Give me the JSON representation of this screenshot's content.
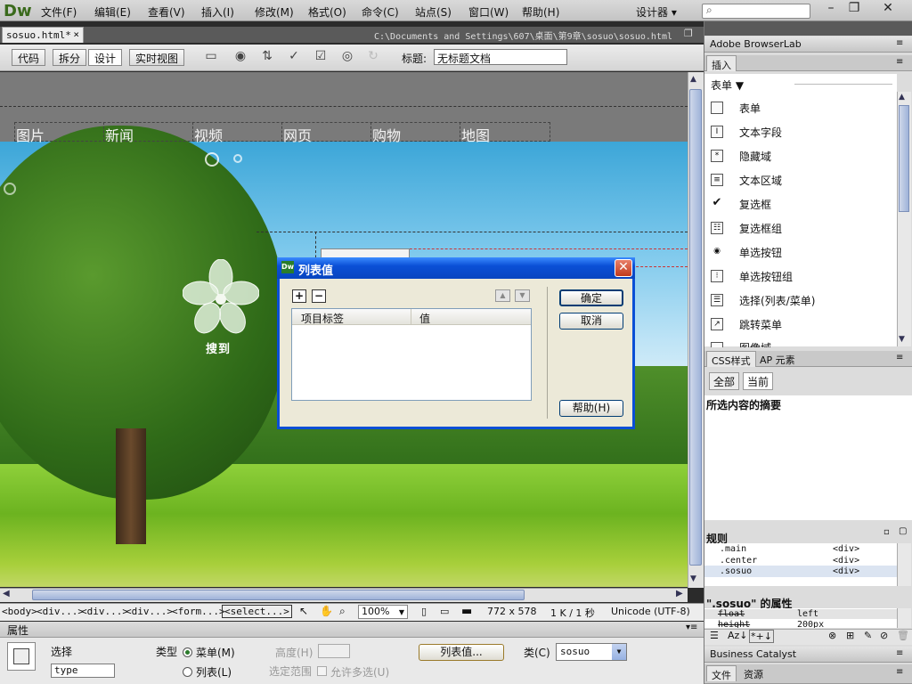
{
  "app": {
    "logo": "Dw",
    "workspace": "设计器 ▾"
  },
  "menu": [
    "文件(F)",
    "编辑(E)",
    "查看(V)",
    "插入(I)",
    "修改(M)",
    "格式(O)",
    "命令(C)",
    "站点(S)",
    "窗口(W)",
    "帮助(H)"
  ],
  "search": {
    "placeholder": ""
  },
  "document": {
    "tab": "sosuo.html*",
    "path": "C:\\Documents and Settings\\607\\桌面\\第9章\\sosuo\\sosuo.html",
    "views": [
      "代码",
      "拆分",
      "设计",
      "实时视图"
    ],
    "active_view": "设计",
    "title_label": "标题:",
    "title_value": "无标题文档"
  },
  "page": {
    "nav": [
      "图片",
      "新闻",
      "视频",
      "网页",
      "购物",
      "地图"
    ],
    "logo_text": "搜到"
  },
  "dialog": {
    "title": "列表值",
    "columns": [
      "项目标签",
      "值"
    ],
    "ok": "确定",
    "cancel": "取消",
    "help": "帮助(H)"
  },
  "status": {
    "tags": [
      "<body>",
      "<div...>",
      "<div...>",
      "<div...>",
      "<form...>",
      "<select...>"
    ],
    "zoom": "100%",
    "size": "772 x 578",
    "filesize": "1 K / 1 秒",
    "encoding": "Unicode (UTF-8)"
  },
  "properties": {
    "title": "属性",
    "select_label": "选择",
    "name_value": "type",
    "type_label": "类型",
    "type_menu": "菜单(M)",
    "type_list": "列表(L)",
    "height_label": "高度(H)",
    "selection_label": "选定范围",
    "allow_multi": "允许多选(U)",
    "list_values_btn": "列表值...",
    "class_label": "类(C)",
    "class_value": "sosuo"
  },
  "right_panel": {
    "browserlab": "Adobe BrowserLab",
    "insert_tab": "插入",
    "category": "表单 ▼",
    "insert_items": [
      "表单",
      "文本字段",
      "隐藏域",
      "文本区域",
      "复选框",
      "复选框组",
      "单选按钮",
      "单选按钮组",
      "选择(列表/菜单)",
      "跳转菜单",
      "图像域"
    ],
    "insert_icons": [
      "form-icon",
      "text-field-icon",
      "hidden-field-icon",
      "textarea-icon",
      "checkbox-icon",
      "checkbox-group-icon",
      "radio-icon",
      "radio-group-icon",
      "select-icon",
      "jump-menu-icon",
      "image-field-icon"
    ],
    "css_tabs": [
      "CSS样式",
      "AP 元素"
    ],
    "css_modes": [
      "全部",
      "当前"
    ],
    "summary_title": "所选内容的摘要",
    "rules_title": "规则",
    "rules": [
      {
        "selector": ".main",
        "tag": "<div>"
      },
      {
        "selector": ".center",
        "tag": "<div>"
      },
      {
        "selector": ".sosuo",
        "tag": "<div>"
      }
    ],
    "props_title": "\".sosuo\" 的属性",
    "prop_rows": [
      {
        "name": "float",
        "value": "left"
      },
      {
        "name": "height",
        "value": "200px"
      }
    ],
    "business": "Business Catalyst",
    "bottom_tabs": [
      "文件",
      "资源"
    ]
  }
}
